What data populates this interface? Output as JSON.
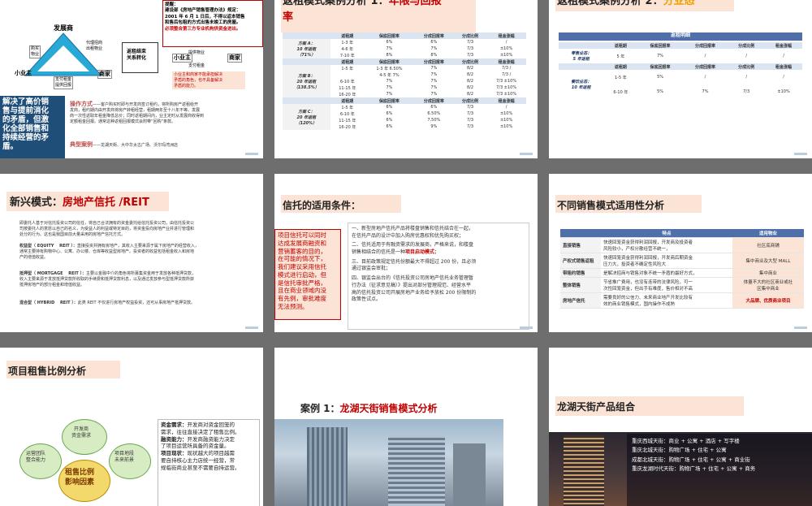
{
  "s1": {
    "notice": [
      "提醒：",
      "建设部《房地产销售管理办法》规定：",
      "2001 年 6 月 1 日后，不得以返本销售",
      "和售后包租的方式出售未竣工的房屋。",
      "必须整合第三方专业机构供资金进出。"
    ],
    "developer": "发展商",
    "buy": [
      "购买",
      "物业"
    ],
    "agent": [
      "代理招商",
      "出租物业"
    ],
    "small": "小业主",
    "merchant": "商家",
    "pay": [
      "支付租金",
      "提供回报"
    ],
    "transform": [
      "返租结束",
      "关系转化"
    ],
    "provide": "提供物业",
    "pay2": "支付租金",
    "small2": "小业主",
    "merchant2": "商家",
    "note": [
      "小业主和商家不能承担解决",
      "矛盾的角色，也不具备解决",
      "矛盾的能力。"
    ],
    "left": [
      "解决了高价销",
      "售与提前消化",
      "的矛盾，但激",
      "化全部销售和",
      "持续经营的矛",
      "盾。"
    ],
    "method_label": "操作方式",
    "method": [
      "——客户购买时即与开发商签订租约，将所购房产返租给开",
      "发商，租约期内由开发商将房产转租经营，租期两年至十八年不等。发展",
      "商一次性返取年租金降低总价；同时返租期间内，业主定时从发展商收得到",
      "定额租金回报。通常这种返租回报模式会附带“回购”条款。"
    ],
    "case_label": "典型案例",
    "case": "——龙湖天街、大中华太古广场、沃尔玛湾洲店"
  },
  "s2": {
    "title_a": "返租模式案例分析 1：",
    "title_b": "年限与回报",
    "title_c": "率",
    "cols": [
      "返租期",
      "保底回报率",
      "分成回报率",
      "分成比例",
      "租金涨幅"
    ],
    "groups": [
      {
        "label": [
          "方案 A：",
          "10 年返租",
          "（71%）"
        ],
        "rows": [
          [
            "1-3 年",
            "6%",
            "6%",
            "7/3",
            "/"
          ],
          [
            "4-6 年",
            "7%",
            "7%",
            "7/3",
            "±10%"
          ],
          [
            "7-10 年",
            "8%",
            "8%",
            "7/3",
            "±10%"
          ]
        ]
      },
      {
        "label": [
          "方案 B：",
          "20 年返租",
          "（138.5%）"
        ],
        "rows": [
          [
            "1-5 年",
            "1-3 年 6.50%",
            "7%",
            "8/2",
            "7/3 /"
          ],
          [
            "",
            "4-5 年 7%",
            "7%",
            "8/2",
            "7/3 /"
          ],
          [
            "6-10 年",
            "7%",
            "7%",
            "8/2",
            "7/3 ±10%"
          ],
          [
            "11-15 年",
            "7%",
            "7%",
            "8/2",
            "7/3 ±10%"
          ],
          [
            "16-20 年",
            "7%",
            "7%",
            "8/2",
            "7/3 ±10%"
          ]
        ]
      },
      {
        "label": [
          "方案 C：",
          "20 年返租",
          "（120%）"
        ],
        "rows": [
          [
            "1-5 年",
            "6%",
            "6%",
            "7/3",
            "/"
          ],
          [
            "6-10 年",
            "6%",
            "6.50%",
            "7/3",
            "±10%"
          ],
          [
            "11-15 年",
            "6%",
            "7.50%",
            "7/3",
            "±10%"
          ],
          [
            "16-20 年",
            "6%",
            "9%",
            "7/3",
            "±10%"
          ]
        ]
      }
    ]
  },
  "s3": {
    "title_a": "返租模式案例分析 2：",
    "title_b": "分业态",
    "caption": "返租明细",
    "cols": [
      "返租期",
      "保底回报率",
      "分成回报率",
      "分成比例",
      "租金涨幅"
    ],
    "g1_label": [
      "零售业态：",
      "5 年返租"
    ],
    "g1_row": [
      "5 年",
      "7%",
      "/",
      "/",
      "/"
    ],
    "g2_label": [
      "餐饮业态：",
      "10 年返租"
    ],
    "g2_rows": [
      [
        "1-5 年",
        "5%",
        "/",
        "/",
        "/"
      ],
      [
        "6-10 年",
        "5%",
        "7%",
        "7/3",
        "±10%"
      ]
    ]
  },
  "s4": {
    "title_a": "新兴模式：",
    "title_b": "房地产信托 /REIT",
    "p1": [
      "即委托人基于对信托投资公司的信任，将自己合法拥有的资金委托给信托投资公司，由信托投资公",
      "司按委托人的意愿以自己的名义，为受益人的利益或特定目的，将资金投向房地产业并进行管理和",
      "处分的行为。这也是我国目前大量采用的房地产信托方式。"
    ],
    "p2_label": "权益型（ EQUITY　 REIT ）：",
    "p2": [
      "直接投资并拥有房地产，其收入主要来源于属下房地产的经营收入，",
      "通常主要持有购物中心、公寓、办公楼、仓库等收益型房地产。投资者的收益包括租金收入和房地",
      "产的增值收益。"
    ],
    "p3_label": "抵押型（ MORTGAGE　 REIT ）：",
    "p3": [
      "主要以金融中介的角色将所募集资金用于发放各种抵押贷款，",
      "收入主要来源于发放抵押贷款所收取的手续费和抵押贷款利息，以及通过发放参与型抵押贷款所获",
      "抵押房地产的部分租金和增值收益。"
    ],
    "p4_label": "混合型（ HYBRID　 REIT ）：",
    "p4": "此类 REIT 不仅进行房地产权益投资，还可从事房地产抵押贷款。"
  },
  "s5": {
    "title": "信托的适用条件：",
    "left": [
      "项目信托可以同时",
      "达成发展商融资和",
      "营销蓄客的目的，",
      "在可能的情况下，",
      "我们建议采用信托",
      "模式进行启动，但",
      "是信托审批严格，",
      "且在商业领域内没",
      "有先例，审批难度",
      "无法预测。"
    ],
    "items": [
      [
        "一、新型房地产信托产品将楼盘销售和信托结合在一起，",
        "在信托产品的设计中加入购房优惠权和优先购买权；"
      ],
      [
        "二、信托适用于有融资需求的发展商，严格来说，和楼盘",
        "销售相结合的信托是一种"
      ],
      [
        "三、目前政策规定信托份额最大不得超过 200 份，且必须",
        "通过银监会审批；"
      ],
      [
        "四、银监会出台的《信托投资公司房地产信托业务管理暂",
        "行办法（征求意见稿）》提出对部分管理规范、经营水平",
        "高的信托投资公司开展房地产业务给予放松 200 份限制的",
        "政策性试点。"
      ]
    ],
    "hl": "项目启动模式",
    "semi": "；"
  },
  "s6": {
    "title": "不同销售模式适用性分析",
    "h": [
      "特点",
      "适用物业"
    ],
    "rows": [
      {
        "k": "直接销售",
        "d": [
          "快速回笼资金获得利润回报，开发商及投资者",
          "风险较小，产权分散经营不统一，"
        ],
        "f": [
          "社区底商铺"
        ]
      },
      {
        "k": "产权式销售返租",
        "d": [
          "快速回笼资金获得利润回报，开发商后期资金",
          "压力大，投资者不确定性风险大"
        ],
        "f": [
          "集中商业及大型 MALL"
        ]
      },
      {
        "k": "带租约销售",
        "d": [
          "是解决招商与销售对象不统一矛盾的最好方式，"
        ],
        "f": [
          "集中商业"
        ]
      },
      {
        "k": "整体销售",
        "d": [
          "节省推广费用，也没有连带的法律风险，可一",
          "次性回笼资金，但出手有难度，售价相对不高"
        ],
        "f": [
          "体量不大的社区商业或社",
          "区集中商业"
        ]
      },
      {
        "k": "房地产信托",
        "d": [
          "需要良好的公信力、未来商业地产开发比较有",
          "效的商业销售模式，国内操作不成熟"
        ],
        "f": [
          "大品牌、优质商业项目"
        ]
      }
    ]
  },
  "s7": {
    "title": "项目租售比例分析",
    "center": [
      "租售比例",
      "影响因素"
    ],
    "petals": [
      [
        "开发商",
        "资金需求"
      ],
      [
        "运营团队",
        "整合能力"
      ],
      [
        "项目地段",
        "未来前景"
      ]
    ],
    "notes": [
      {
        "label": "资金需求：",
        "text": [
          "开发商对资金回笼的",
          "需求，往往直接决定了租售比例。"
        ]
      },
      {
        "label": "融资能力：",
        "text": [
          "开发商融资能力决定",
          "了项目运营所具备的资金量。"
        ]
      },
      {
        "label": "项目现状：",
        "text": [
          "现状越大的项目越需",
          "要自持核心主力店统一经营，常",
          "规临街商业甚至不需要自持运营。"
        ]
      }
    ]
  },
  "s8": {
    "title_a": "案例 1：",
    "title_b": "龙湖天街销售模式分析"
  },
  "s9": {
    "title": "龙湖天街产品组合",
    "lines": [
      "重庆西城天街：商业 + 公寓 + 酒店 + 写字楼",
      "重庆北城天街：购物广场 + 住宅 + 公寓",
      "成都北城天街：购物广场 + 住宅 + 公寓 + 商业街",
      "重庆龙湖时代天街：购物广场 + 住宅 + 公寓 + 商务"
    ]
  }
}
